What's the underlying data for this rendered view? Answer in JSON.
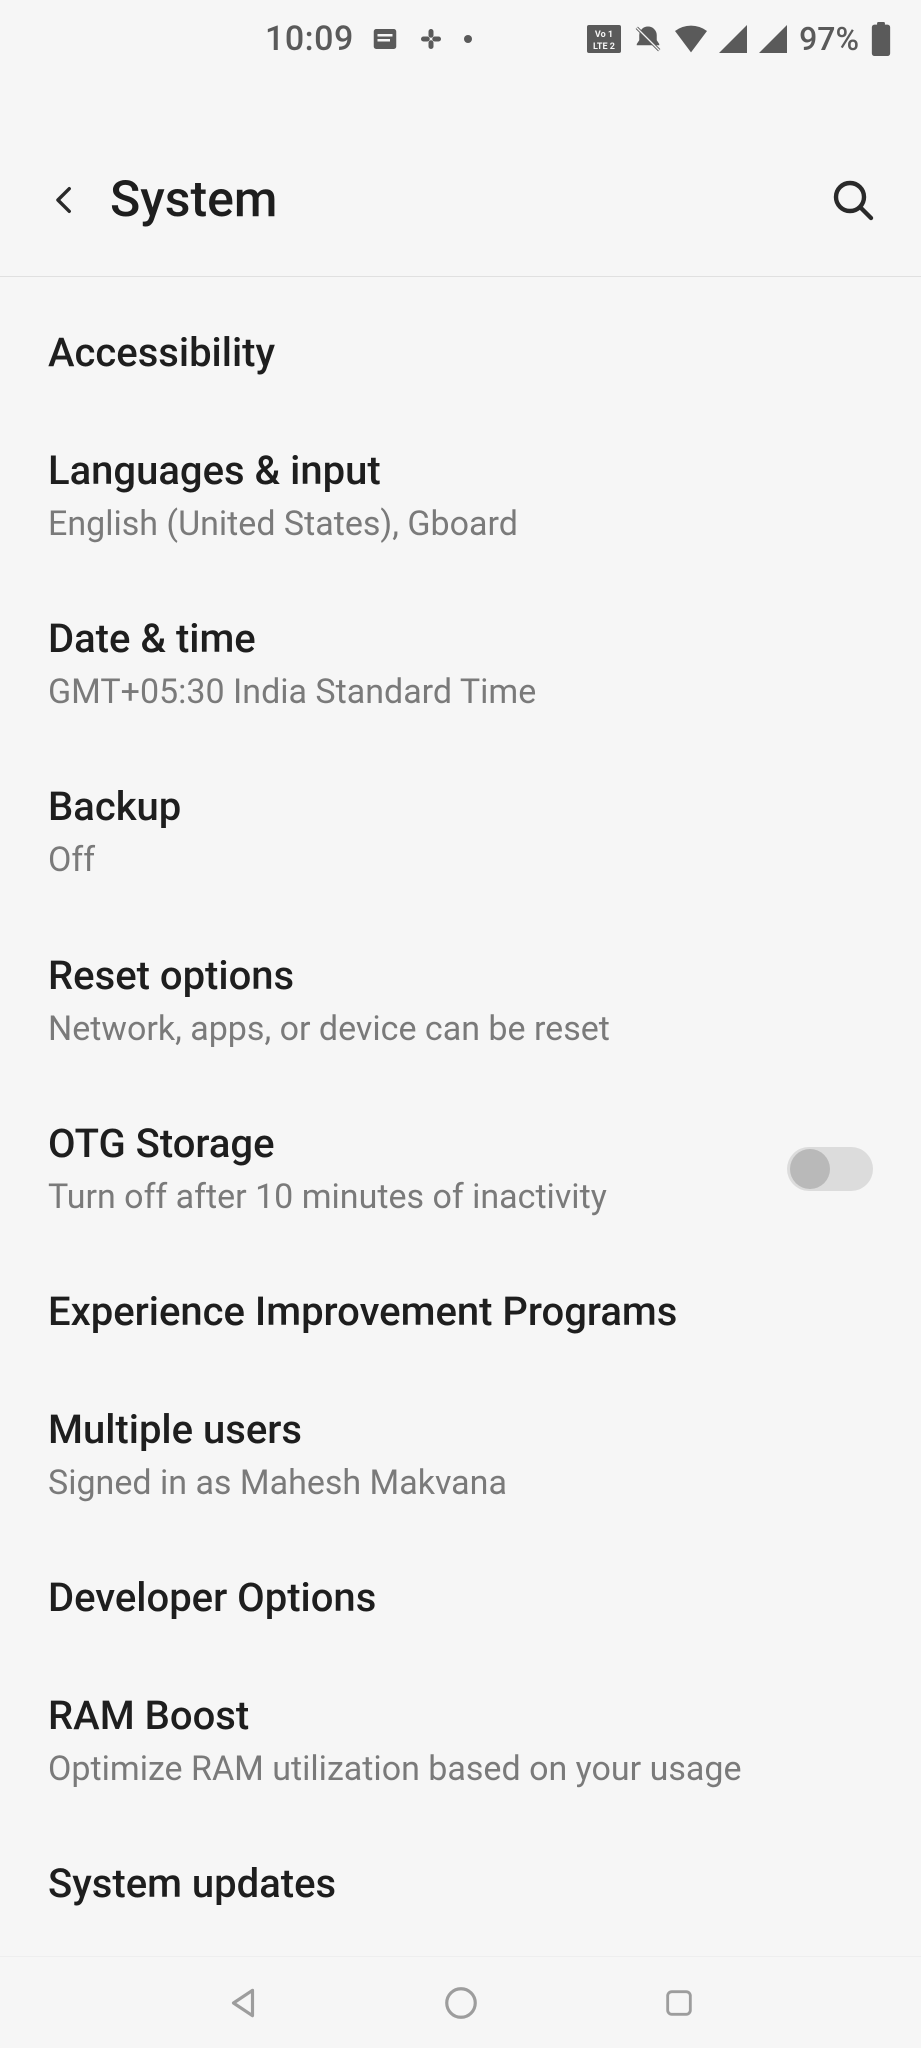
{
  "status": {
    "time": "10:09",
    "battery_pct": "97%"
  },
  "header": {
    "title": "System"
  },
  "items": [
    {
      "title": "Accessibility",
      "subtitle": null,
      "toggle": false
    },
    {
      "title": "Languages & input",
      "subtitle": "English (United States), Gboard",
      "toggle": false
    },
    {
      "title": "Date & time",
      "subtitle": "GMT+05:30 India Standard Time",
      "toggle": false
    },
    {
      "title": "Backup",
      "subtitle": "Off",
      "toggle": false
    },
    {
      "title": "Reset options",
      "subtitle": "Network, apps, or device can be reset",
      "toggle": false
    },
    {
      "title": "OTG Storage",
      "subtitle": "Turn off after 10 minutes of inactivity",
      "toggle": true,
      "toggle_on": false
    },
    {
      "title": "Experience Improvement Programs",
      "subtitle": null,
      "toggle": false
    },
    {
      "title": "Multiple users",
      "subtitle": "Signed in as Mahesh Makvana",
      "toggle": false
    },
    {
      "title": "Developer Options",
      "subtitle": null,
      "toggle": false
    },
    {
      "title": "RAM Boost",
      "subtitle": "Optimize RAM utilization based on your usage",
      "toggle": false
    },
    {
      "title": "System updates",
      "subtitle": null,
      "toggle": false
    }
  ]
}
